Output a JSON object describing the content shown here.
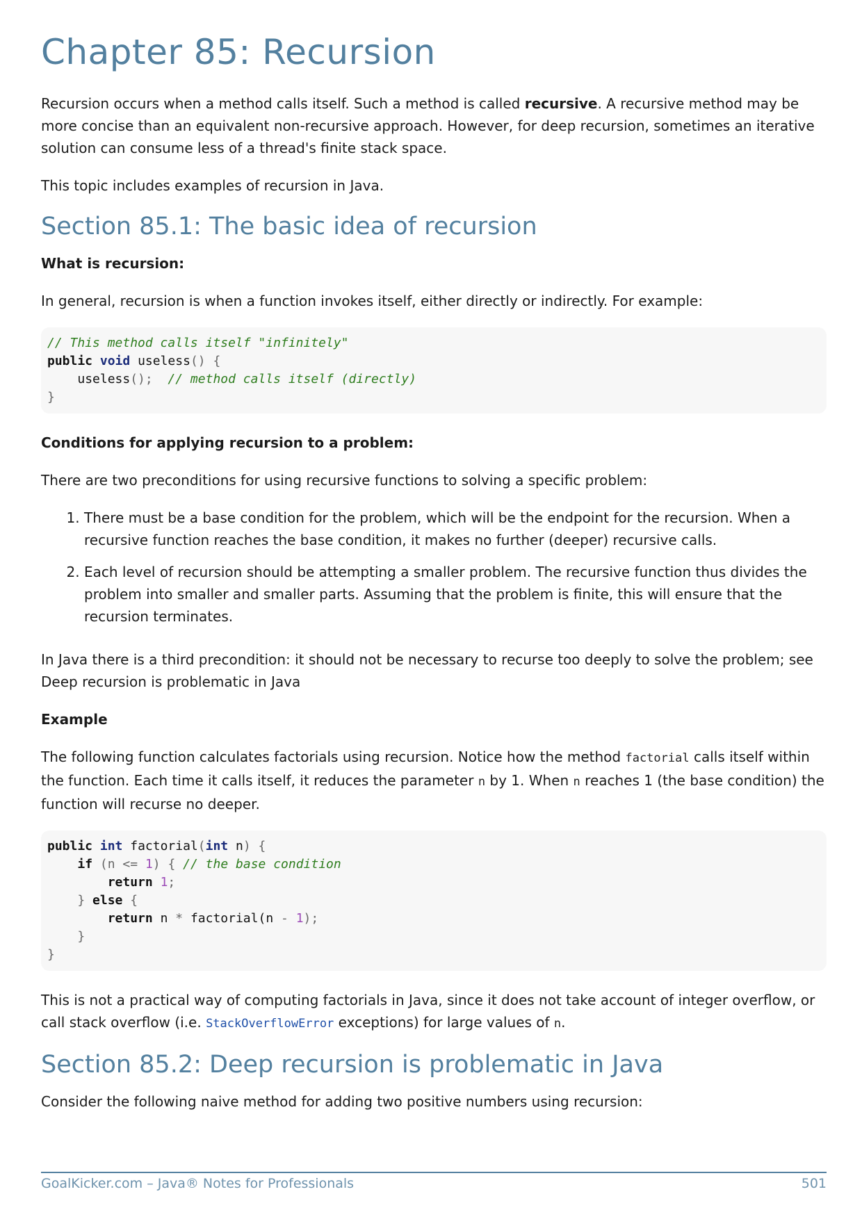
{
  "chapter_title": "Chapter 85: Recursion",
  "intro": {
    "p1_before": "Recursion occurs when a method calls itself. Such a method is called ",
    "p1_bold": "recursive",
    "p1_after": ". A recursive method may be more concise than an equivalent non-recursive approach. However, for deep recursion, sometimes an iterative solution can consume less of a thread's finite stack space.",
    "p2": "This topic includes examples of recursion in Java."
  },
  "section1": {
    "title": "Section 85.1: The basic idea of recursion",
    "what_heading": "What is recursion:",
    "what_text": "In general, recursion is when a function invokes itself, either directly or indirectly. For example:",
    "code1": {
      "line1_comment": "// This method calls itself \"infinitely\"",
      "line2_public": "public",
      "line2_void": "void",
      "line2_name": "useless",
      "line2_parens": "()",
      "line2_brace": "{",
      "line3_call": "useless",
      "line3_parens": "();",
      "line3_comment": "// method calls itself (directly)",
      "line4_brace": "}"
    },
    "conditions_heading": "Conditions for applying recursion to a problem:",
    "conditions_text": "There are two preconditions for using recursive functions to solving a specific problem:",
    "conditions": [
      "There must be a base condition for the problem, which will be the endpoint for the recursion. When a recursive function reaches the base condition, it makes no further (deeper) recursive calls.",
      "Each level of recursion should be attempting a smaller problem. The recursive function thus divides the problem into smaller and smaller parts. Assuming that the problem is finite, this will ensure that the recursion terminates."
    ],
    "java_text": "In Java there is a third precondition: it should not be necessary to recurse too deeply to solve the problem; see Deep recursion is problematic in Java",
    "example_heading": "Example",
    "example_text": {
      "t1": "The following function calculates factorials using recursion. Notice how the method ",
      "c1": "factorial",
      "t2": " calls itself within the function. Each time it calls itself, it reduces the parameter ",
      "c2": "n",
      "t3": " by 1. When ",
      "c3": "n",
      "t4": " reaches 1 (the base condition) the function will recurse no deeper."
    },
    "code2": {
      "public": "public",
      "int1": "int",
      "name": "factorial",
      "open_paren": "(",
      "int2": "int",
      "param": "n",
      "close": ") {",
      "if": "if",
      "if_cond_open": "(n",
      "le": "<=",
      "one": "1",
      "if_cond_close": ") {",
      "base_comment": "// the base condition",
      "return1": "return",
      "ret_one": "1",
      "semi": ";",
      "close_if": "}",
      "else": "else",
      "else_brace": "{",
      "return2": "return",
      "rec_n": "n",
      "star": "*",
      "rec_call": "factorial(n",
      "minus": "-",
      "rec_one": "1",
      "rec_end": ");",
      "close_else": "}",
      "close_method": "}"
    },
    "note": {
      "t1": "This is not a practical way of computing factorials in Java, since it does not take account of integer overflow, or call stack overflow (i.e. ",
      "c1": "StackOverflowError",
      "t2": " exceptions) for large values of ",
      "c2": "n",
      "t3": "."
    }
  },
  "section2": {
    "title": "Section 85.2: Deep recursion is problematic in Java",
    "text": "Consider the following naive method for adding two positive numbers using recursion:"
  },
  "footer": {
    "left": "GoalKicker.com – Java® Notes for Professionals",
    "page": "501"
  },
  "colors": {
    "heading": "#53809f",
    "keyword_type": "#1a2b7a",
    "comment": "#2e7d1e",
    "number": "#9c4bb7",
    "link_code": "#1e4fa8",
    "code_bg": "#f7f7f7"
  }
}
